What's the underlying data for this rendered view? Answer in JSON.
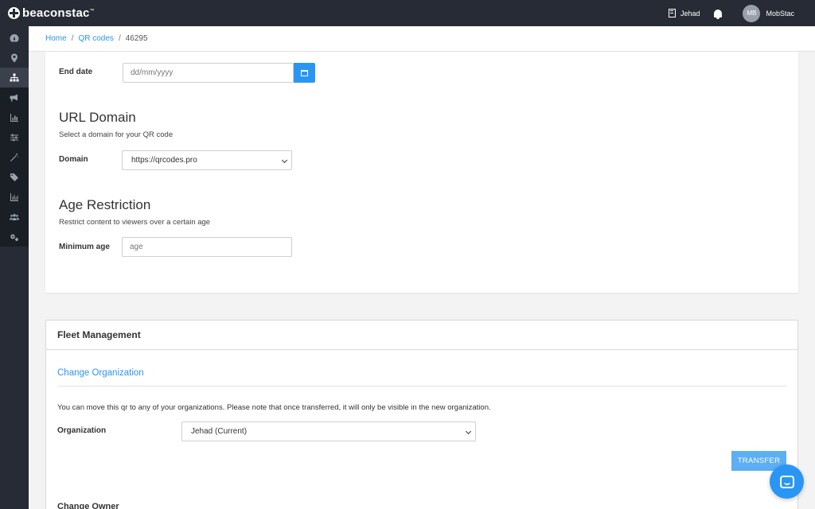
{
  "app": {
    "brand": "beaconstac",
    "brand_mark": "™"
  },
  "topbar": {
    "org_name": "Jehad",
    "avatar_initials": "MB",
    "user_name": "MobStac"
  },
  "sidebar": {
    "items": [
      {
        "icon": "dashboard-icon"
      },
      {
        "icon": "location-pin-icon"
      },
      {
        "icon": "sitemap-icon",
        "active": true
      },
      {
        "icon": "megaphone-icon"
      },
      {
        "icon": "bar-chart-icon"
      },
      {
        "icon": "sliders-icon"
      },
      {
        "icon": "magic-wand-icon"
      },
      {
        "icon": "tags-icon"
      },
      {
        "icon": "analytics-icon"
      },
      {
        "icon": "users-icon"
      },
      {
        "icon": "cogs-icon"
      }
    ]
  },
  "breadcrumb": {
    "home": "Home",
    "qr_codes": "QR codes",
    "current": "46295"
  },
  "schedule": {
    "end_date_label": "End date",
    "end_date_placeholder": "dd/mm/yyyy"
  },
  "url_domain": {
    "title": "URL Domain",
    "subtitle": "Select a domain for your QR code",
    "domain_label": "Domain",
    "domain_value": "https://qrcodes.pro"
  },
  "age_restriction": {
    "title": "Age Restriction",
    "subtitle": "Restrict content to viewers over a certain age",
    "min_age_label": "Minimum age",
    "min_age_placeholder": "age"
  },
  "fleet": {
    "title": "Fleet Management",
    "change_org_title": "Change Organization",
    "note": "You can move this qr to any of your organizations. Please note that once transferred, it will only be visible in the new organization.",
    "org_label": "Organization",
    "org_value": "Jehad (Current)",
    "transfer_label": "TRANSFER",
    "change_owner_title": "Change Owner"
  },
  "colors": {
    "accent": "#2a96f3",
    "topbar": "#262b35"
  }
}
